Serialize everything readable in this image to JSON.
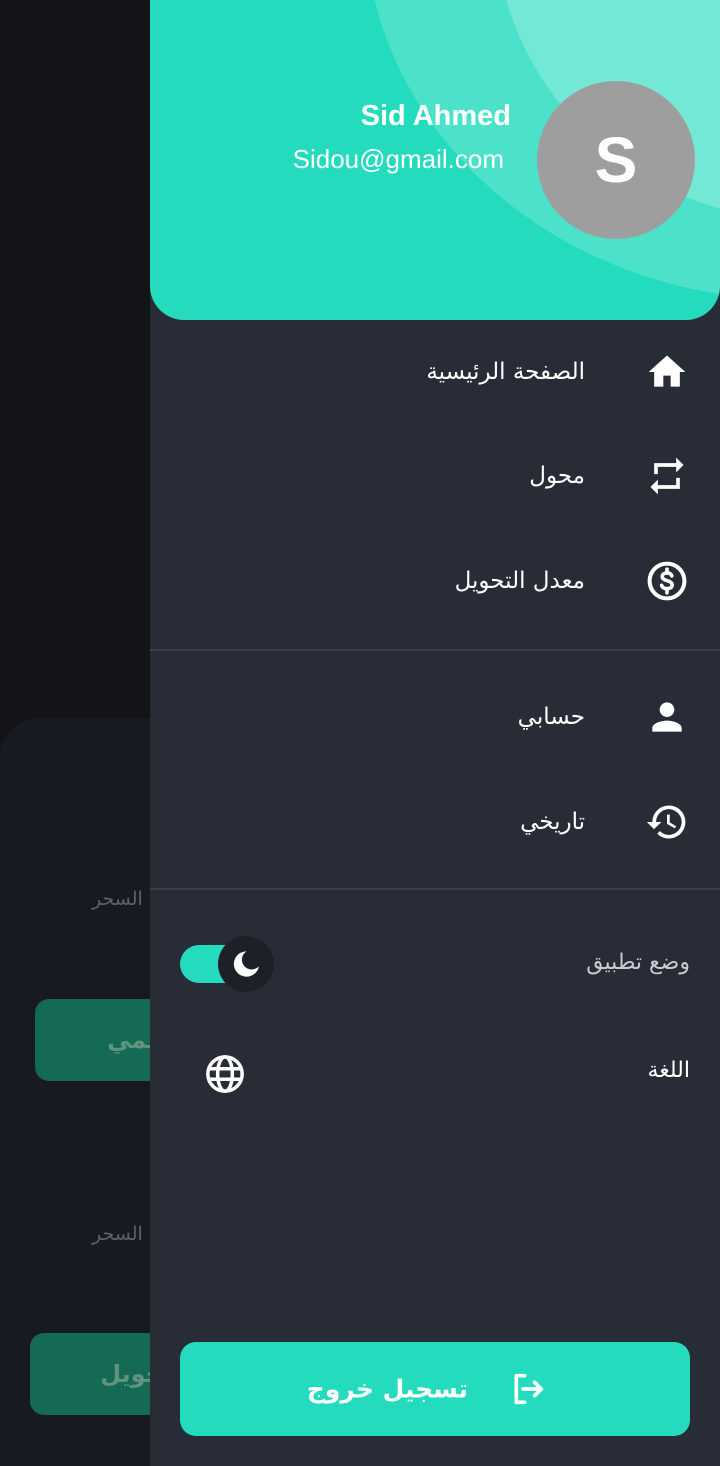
{
  "background": {
    "label_1": "السحر",
    "button_1": "رقمي",
    "label_2": "السحر",
    "button_2": "تحويل"
  },
  "drawer": {
    "user": {
      "name": "Sid Ahmed",
      "email": "Sidou@gmail.com",
      "avatar_letter": "S"
    },
    "menu": [
      {
        "label": "الصفحة الرئيسية",
        "icon": "home-icon"
      },
      {
        "label": "محول",
        "icon": "swap-icon"
      },
      {
        "label": "معدل التحويل",
        "icon": "dollar-circle-icon"
      },
      {
        "label": "حسابي",
        "icon": "person-icon"
      },
      {
        "label": "تاريخي",
        "icon": "history-icon"
      }
    ],
    "settings": {
      "theme_label": "وضع تطبيق",
      "theme_dark_enabled": true,
      "language_label": "اللغة"
    },
    "logout_label": "تسجيل خروج"
  },
  "colors": {
    "accent": "#24dcbd",
    "drawer_bg": "#282c36",
    "avatar_bg": "#9e9e9e"
  }
}
